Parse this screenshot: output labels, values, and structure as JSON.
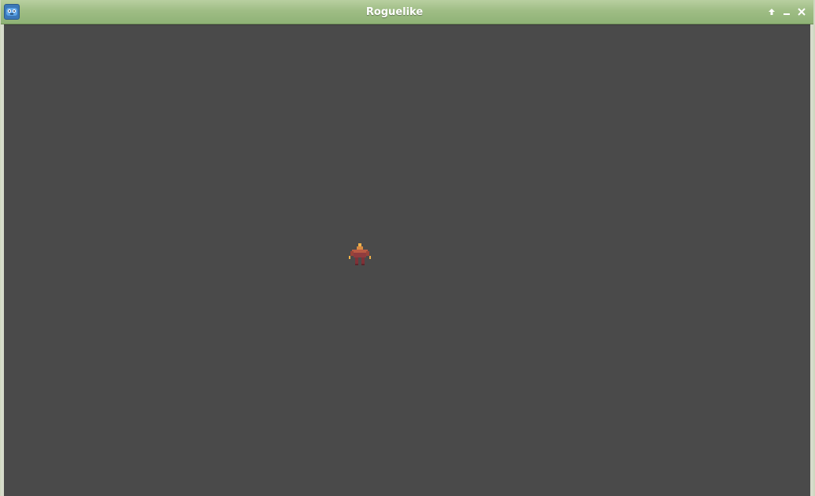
{
  "window": {
    "title": "Roguelike",
    "app_icon": "godot-icon",
    "controls": [
      "maximize-icon",
      "minimize-icon",
      "close-icon"
    ]
  },
  "scene": {
    "background_color": "#4a4a4a",
    "player_sprite": "player-character-icon"
  }
}
